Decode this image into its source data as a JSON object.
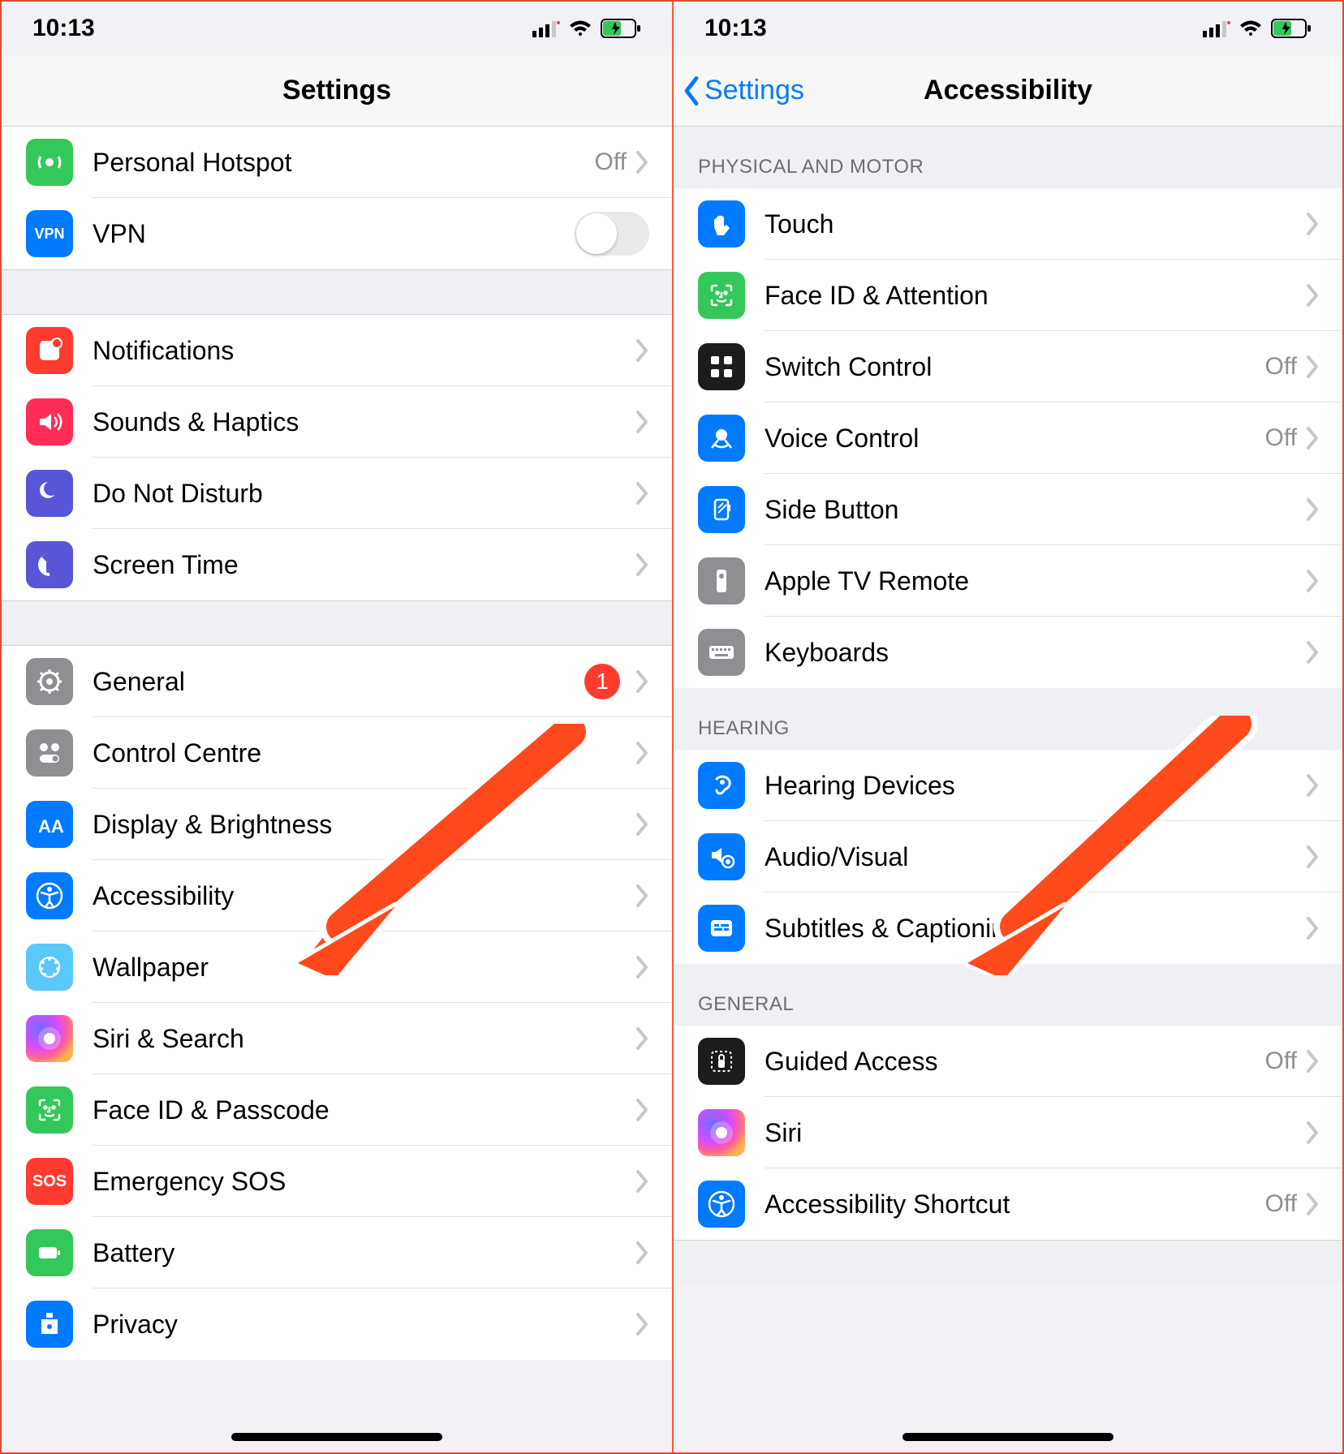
{
  "status": {
    "time": "10:13"
  },
  "left": {
    "title": "Settings",
    "groups": [
      [
        {
          "icon": "hotspot",
          "label": "Personal Hotspot",
          "detail": "Off",
          "chevron": true,
          "color": "i-green"
        },
        {
          "icon": "vpn",
          "label": "VPN",
          "switch": true,
          "color": "i-vpn"
        }
      ],
      [
        {
          "icon": "notifications",
          "label": "Notifications",
          "chevron": true,
          "color": "i-red"
        },
        {
          "icon": "sounds",
          "label": "Sounds & Haptics",
          "chevron": true,
          "color": "i-redish"
        },
        {
          "icon": "dnd",
          "label": "Do Not Disturb",
          "chevron": true,
          "color": "i-purple"
        },
        {
          "icon": "screentime",
          "label": "Screen Time",
          "chevron": true,
          "color": "i-purple"
        }
      ],
      [
        {
          "icon": "general",
          "label": "General",
          "badge": "1",
          "chevron": true,
          "color": "i-grey"
        },
        {
          "icon": "controlcentre",
          "label": "Control Centre",
          "chevron": true,
          "color": "i-grey"
        },
        {
          "icon": "display",
          "label": "Display & Brightness",
          "chevron": true,
          "color": "i-blue"
        },
        {
          "icon": "accessibility",
          "label": "Accessibility",
          "chevron": true,
          "color": "i-blue"
        },
        {
          "icon": "wallpaper",
          "label": "Wallpaper",
          "chevron": true,
          "color": "i-lblue"
        },
        {
          "icon": "siri",
          "label": "Siri & Search",
          "chevron": true,
          "color": "i-siri"
        },
        {
          "icon": "faceid",
          "label": "Face ID & Passcode",
          "chevron": true,
          "color": "i-green"
        },
        {
          "icon": "sos",
          "label": "Emergency SOS",
          "chevron": true,
          "color": "i-sos"
        },
        {
          "icon": "battery",
          "label": "Battery",
          "chevron": true,
          "color": "i-green"
        },
        {
          "icon": "privacy",
          "label": "Privacy",
          "chevron": true,
          "color": "i-blue"
        }
      ]
    ]
  },
  "right": {
    "back": "Settings",
    "title": "Accessibility",
    "sections": [
      {
        "header": "PHYSICAL AND MOTOR",
        "rows": [
          {
            "icon": "touch",
            "label": "Touch",
            "chevron": true,
            "color": "i-blue"
          },
          {
            "icon": "faceid",
            "label": "Face ID & Attention",
            "chevron": true,
            "color": "i-green"
          },
          {
            "icon": "switchcontrol",
            "label": "Switch Control",
            "detail": "Off",
            "chevron": true,
            "color": "i-dark"
          },
          {
            "icon": "voicecontrol",
            "label": "Voice Control",
            "detail": "Off",
            "chevron": true,
            "color": "i-blue"
          },
          {
            "icon": "sidebutton",
            "label": "Side Button",
            "chevron": true,
            "color": "i-blue"
          },
          {
            "icon": "appletv",
            "label": "Apple TV Remote",
            "chevron": true,
            "color": "i-grey"
          },
          {
            "icon": "keyboard",
            "label": "Keyboards",
            "chevron": true,
            "color": "i-grey"
          }
        ]
      },
      {
        "header": "HEARING",
        "rows": [
          {
            "icon": "hearing",
            "label": "Hearing Devices",
            "chevron": true,
            "color": "i-blue"
          },
          {
            "icon": "audiovisual",
            "label": "Audio/Visual",
            "chevron": true,
            "color": "i-blue"
          },
          {
            "icon": "subtitles",
            "label": "Subtitles & Captioning",
            "chevron": true,
            "color": "i-blue"
          }
        ]
      },
      {
        "header": "GENERAL",
        "rows": [
          {
            "icon": "guidedaccess",
            "label": "Guided Access",
            "detail": "Off",
            "chevron": true,
            "color": "i-dark"
          },
          {
            "icon": "siri",
            "label": "Siri",
            "chevron": true,
            "color": "i-siri"
          },
          {
            "icon": "shortcut",
            "label": "Accessibility Shortcut",
            "detail": "Off",
            "chevron": true,
            "color": "i-blue"
          }
        ]
      }
    ]
  }
}
